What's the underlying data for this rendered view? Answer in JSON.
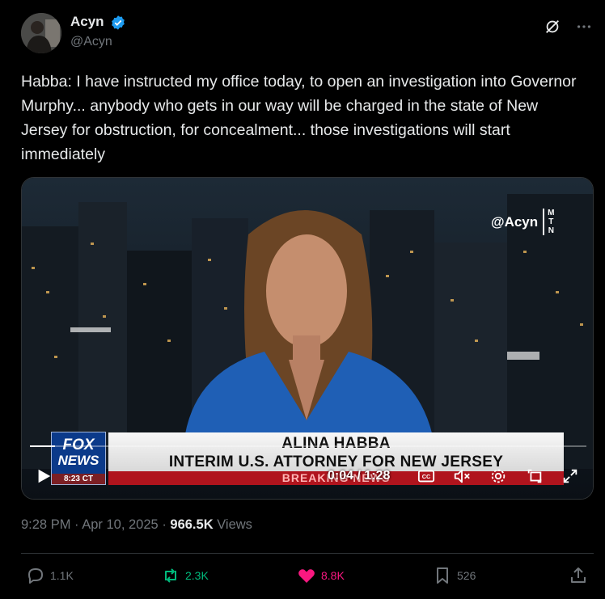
{
  "author": {
    "name": "Acyn",
    "handle": "@Acyn"
  },
  "tweet": {
    "text": "Habba: I have instructed my office today, to open an investigation into Governor Murphy... anybody who gets in our way will be charged in the state of New Jersey for obstruction, for concealment... those investigations will start immediately"
  },
  "video": {
    "watermark": "@Acyn",
    "watermark_badge": [
      "M",
      "T",
      "N"
    ],
    "chyron_name": "ALINA HABBA",
    "chyron_title": "INTERIM U.S. ATTORNEY FOR NEW JERSEY",
    "breaking": "BREAKING NEWS",
    "network_line1": "FOX",
    "network_line2": "NEWS",
    "network_time": "8:23 CT",
    "time_readout": "0:04 / 1:28",
    "progress": 0.045
  },
  "meta": {
    "time": "9:28 PM",
    "date": "Apr 10, 2025",
    "views_count": "966.5K",
    "views_label": "Views"
  },
  "actions": {
    "replies": "1.1K",
    "reposts": "2.3K",
    "likes": "8.8K",
    "bookmarks": "526"
  },
  "colors": {
    "verified": "#1d9bf0",
    "repost": "#00ba7c",
    "like": "#f91880",
    "muted": "#71767b"
  }
}
